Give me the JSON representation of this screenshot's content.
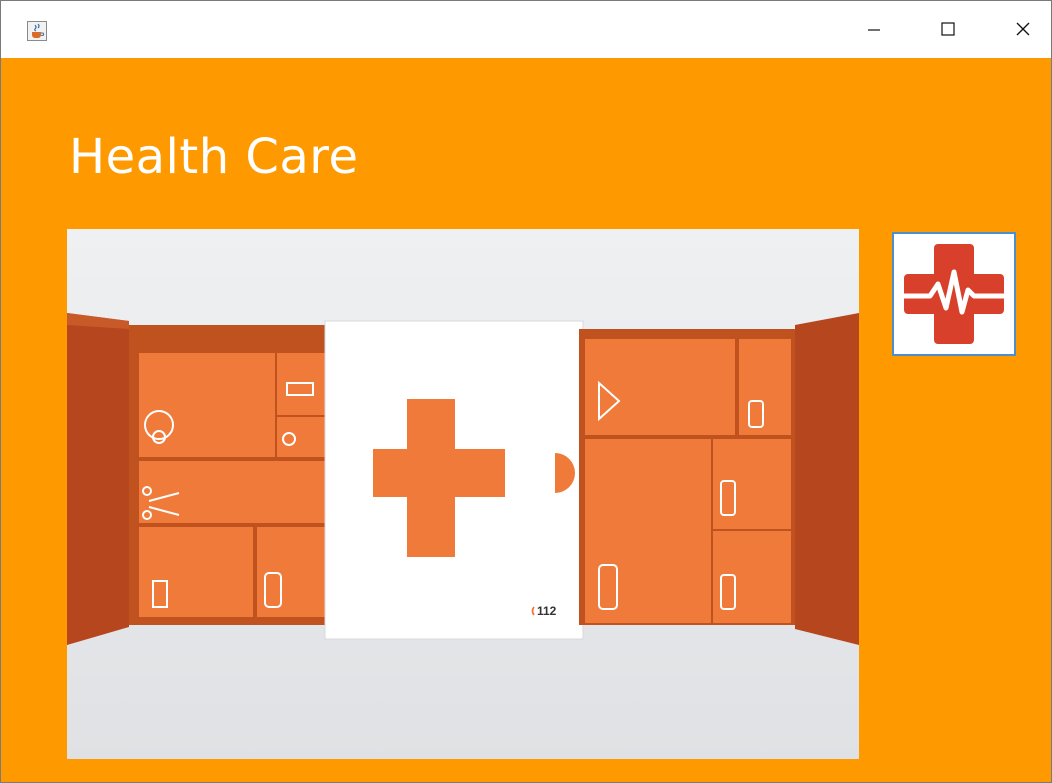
{
  "window": {
    "app_icon": "java-coffee-cup-icon",
    "controls": {
      "minimize": "minimize-icon",
      "maximize": "maximize-icon",
      "close": "close-icon"
    }
  },
  "main": {
    "title": "Health Care",
    "image": {
      "icon": "first-aid-kit-photo",
      "emergency_number": "112"
    },
    "logo_button": {
      "icon": "medical-cross-heartbeat-icon",
      "cross_color": "#d9402b"
    }
  },
  "colors": {
    "background": "#ff9900",
    "heading": "#ffffff",
    "accent_orange": "#f07a3a"
  }
}
